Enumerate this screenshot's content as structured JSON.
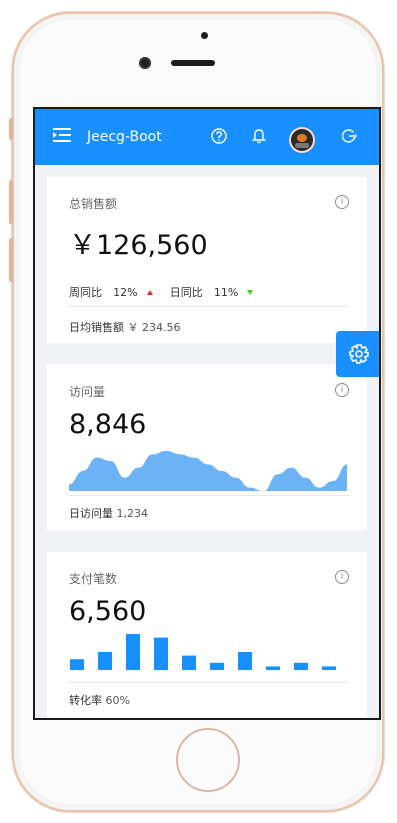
{
  "header": {
    "app_title": "Jeecg-Boot",
    "icons": [
      "menu-icon",
      "help-icon",
      "bell-icon",
      "avatar",
      "logout-icon"
    ]
  },
  "cards": {
    "sales": {
      "title": "总销售额",
      "value": "￥126,560",
      "week_label": "周同比",
      "week_value": "12%",
      "day_label": "日同比",
      "day_value": "11%",
      "footer_label": "日均销售额",
      "footer_value": "￥ 234.56"
    },
    "visits": {
      "title": "访问量",
      "value": "8,846",
      "footer_label": "日访问量",
      "footer_value": "1,234"
    },
    "payments": {
      "title": "支付笔数",
      "value": "6,560",
      "footer_label": "转化率",
      "footer_value": "60%"
    }
  },
  "colors": {
    "primary": "#1890ff",
    "area_fill": "#6cb3f5",
    "up": "#f5222d",
    "down": "#52c41a"
  },
  "chart_data": [
    {
      "type": "area",
      "x": [
        0,
        1,
        2,
        3,
        4,
        5,
        6,
        7,
        8,
        9,
        10,
        11,
        12,
        13,
        14,
        15,
        16,
        17,
        18,
        19,
        20
      ],
      "values": [
        2,
        6,
        10,
        9,
        4,
        7,
        11,
        12,
        11,
        10,
        8,
        6,
        4,
        1,
        0,
        5,
        7,
        4,
        1,
        3,
        8
      ],
      "ylim": [
        0,
        12
      ]
    },
    {
      "type": "bar",
      "x": [
        0,
        1,
        2,
        3,
        4,
        5,
        6,
        7,
        8,
        9
      ],
      "values": [
        3,
        5,
        10,
        9,
        4,
        2,
        5,
        1,
        2,
        1
      ],
      "ylim": [
        0,
        10
      ]
    }
  ]
}
